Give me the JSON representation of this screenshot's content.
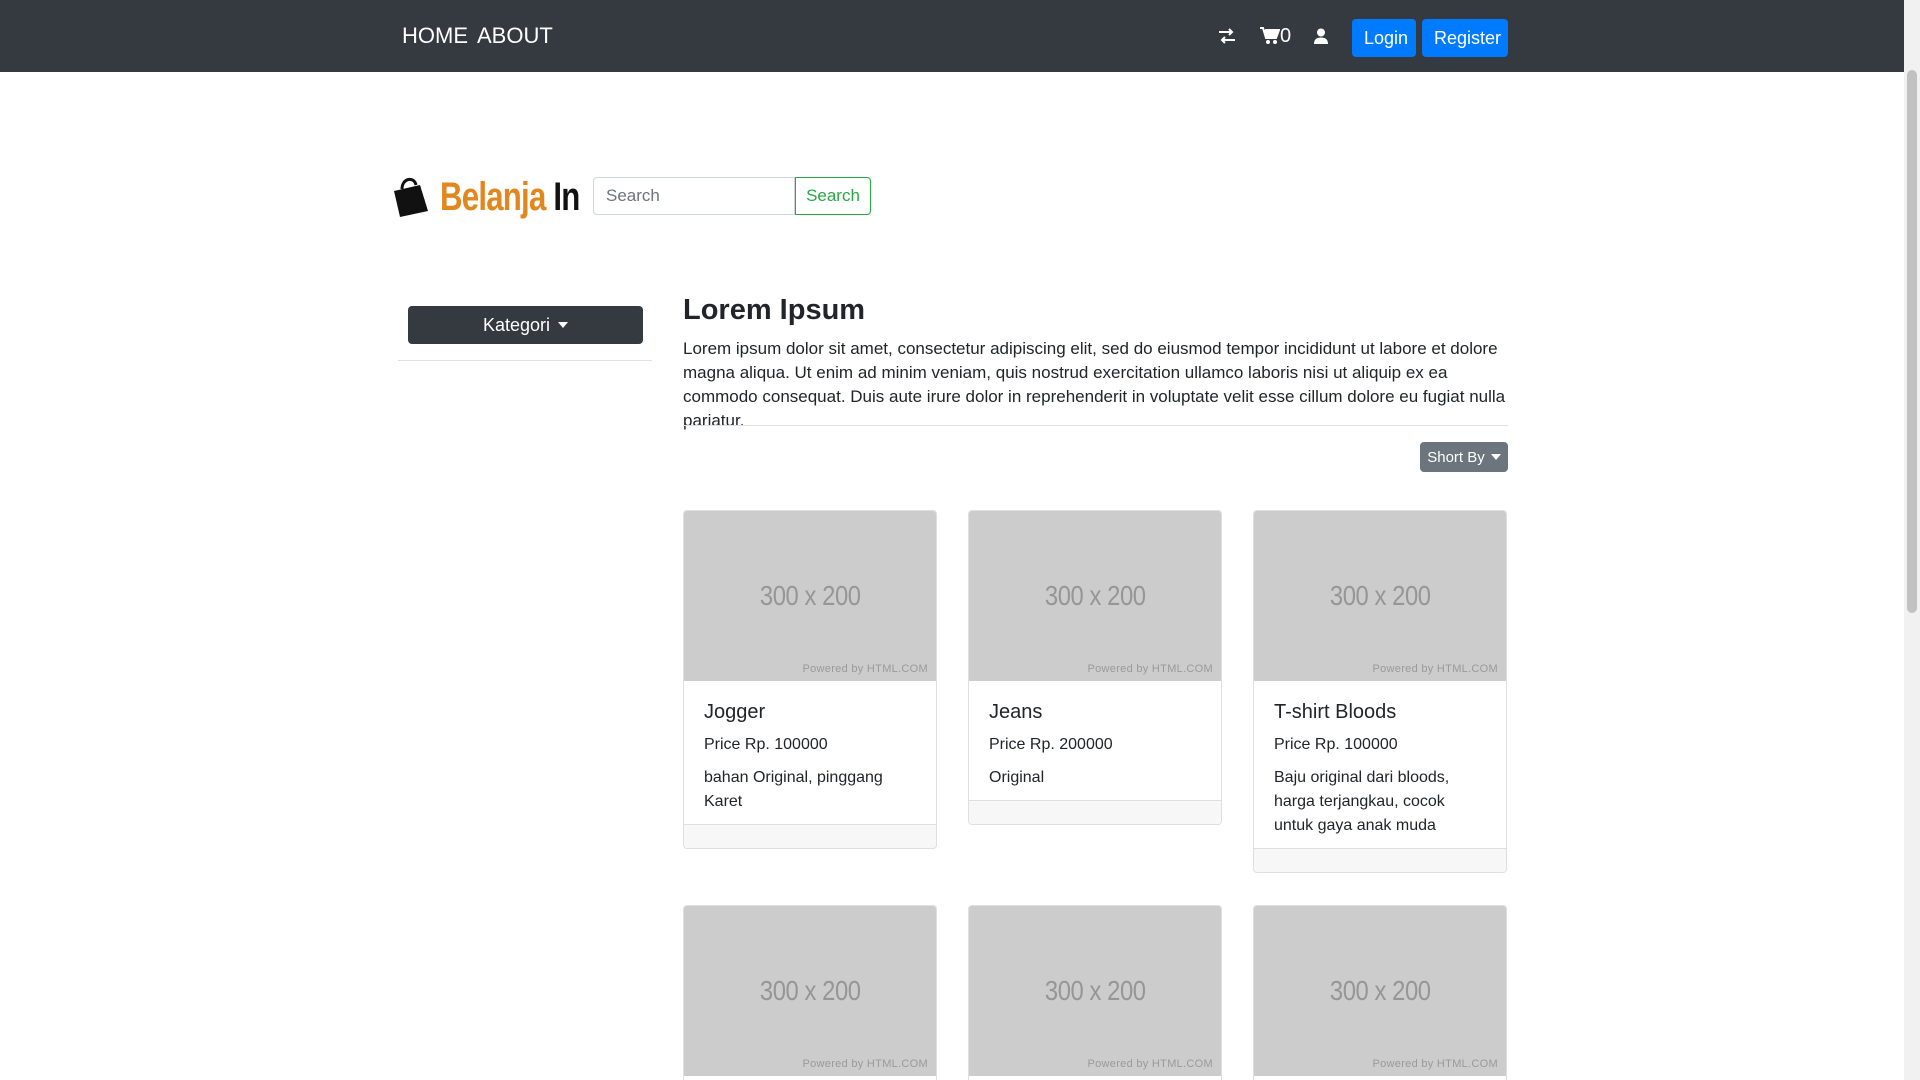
{
  "nav": {
    "home": "HOME",
    "about": "ABOUT",
    "cart_count": "0",
    "login": "Login",
    "register": "Register"
  },
  "brand": {
    "part1": "Belanja",
    "part2": " In"
  },
  "search": {
    "placeholder": "Search",
    "button": "Search"
  },
  "sidebar": {
    "kategori": "Kategori"
  },
  "main": {
    "title": "Lorem Ipsum",
    "description": "Lorem ipsum dolor sit amet, consectetur adipiscing elit, sed do eiusmod tempor incididunt ut labore et dolore magna aliqua. Ut enim ad minim veniam, quis nostrud exercitation ullamco laboris nisi ut aliquip ex ea commodo consequat. Duis aute irure dolor in reprehenderit in voluptate velit esse cillum dolore eu fugiat nulla pariatur.",
    "sort": "Short By"
  },
  "products": [
    {
      "img": "300 x 200",
      "powered": "Powered by HTML.COM",
      "title": "Jogger",
      "price": "Price Rp. 100000",
      "desc": "bahan Original, pinggang Karet"
    },
    {
      "img": "300 x 200",
      "powered": "Powered by HTML.COM",
      "title": "Jeans",
      "price": "Price Rp. 200000",
      "desc": "Original"
    },
    {
      "img": "300 x 200",
      "powered": "Powered by HTML.COM",
      "title": "T-shirt Bloods",
      "price": "Price Rp. 100000",
      "desc": "Baju original dari bloods, harga terjangkau, cocok untuk gaya anak muda"
    },
    {
      "img": "300 x 200",
      "powered": "Powered by HTML.COM"
    },
    {
      "img": "300 x 200",
      "powered": "Powered by HTML.COM"
    },
    {
      "img": "300 x 200",
      "powered": "Powered by HTML.COM"
    }
  ],
  "colors": {
    "navbar": "#343a40",
    "primary": "#007bff",
    "success": "#28a745",
    "secondary": "#6c757d",
    "brand_orange": "#e2861e"
  }
}
